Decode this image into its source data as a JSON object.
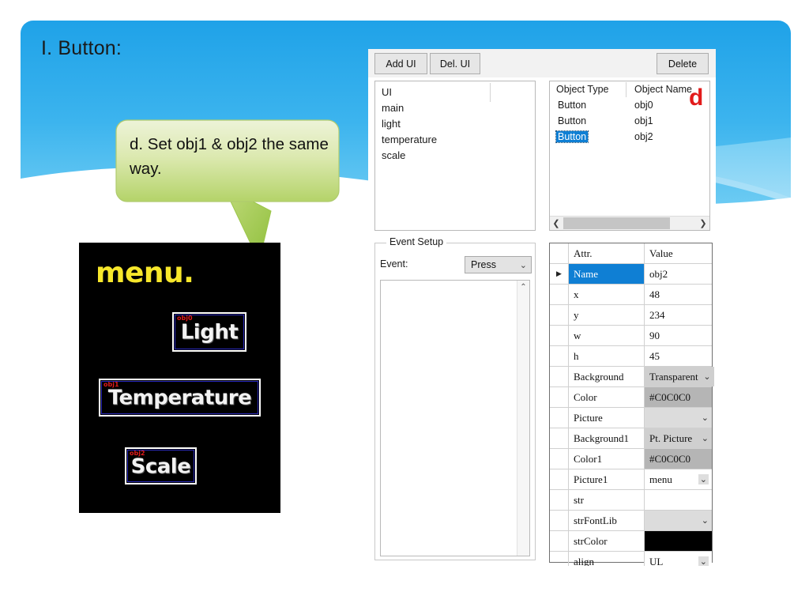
{
  "slide": {
    "title": "I. Button:",
    "callout_text": "d. Set obj1 & obj2 the same way.",
    "accent_blue": "#2BA8E8",
    "callout_green": "#C6DC8A"
  },
  "preview": {
    "title": "menu.",
    "buttons": [
      {
        "label": "Light",
        "tag": "obj0"
      },
      {
        "label": "Temperature",
        "tag": "obj1"
      },
      {
        "label": "Scale",
        "tag": "obj2"
      }
    ]
  },
  "editor": {
    "toolbar": {
      "add_ui": "Add UI",
      "del_ui": "Del. UI",
      "delete": "Delete"
    },
    "ui_list": {
      "header": "UI",
      "items": [
        "main",
        "light",
        "temperature",
        "scale"
      ]
    },
    "object_list": {
      "headers": [
        "Object Type",
        "Object Name"
      ],
      "rows": [
        {
          "type": "Button",
          "name": "obj0",
          "selected": false
        },
        {
          "type": "Button",
          "name": "obj1",
          "selected": false
        },
        {
          "type": "Button",
          "name": "obj2",
          "selected": true
        }
      ],
      "annotation": "d",
      "annotation_color": "#E21B1B",
      "scroll_left_icon": "chevron-left",
      "scroll_right_icon": "chevron-right"
    },
    "event_setup": {
      "legend": "Event Setup",
      "event_label": "Event:",
      "event_value": "Press",
      "code_value": ""
    },
    "property_grid": {
      "headers": [
        "",
        "Attr.",
        "Value"
      ],
      "rows": [
        {
          "marker": "▶",
          "attr": "Name",
          "value": "obj2",
          "selected": true,
          "style": "white"
        },
        {
          "marker": "",
          "attr": "x",
          "value": "48",
          "selected": false,
          "style": "white"
        },
        {
          "marker": "",
          "attr": "y",
          "value": "234",
          "selected": false,
          "style": "white"
        },
        {
          "marker": "",
          "attr": "w",
          "value": "90",
          "selected": false,
          "style": "white"
        },
        {
          "marker": "",
          "attr": "h",
          "value": "45",
          "selected": false,
          "style": "white"
        },
        {
          "marker": "",
          "attr": "Background",
          "value": "Transparent",
          "selected": false,
          "style": "combo"
        },
        {
          "marker": "",
          "attr": "Color",
          "value": "#C0C0C0",
          "selected": false,
          "style": "gray"
        },
        {
          "marker": "",
          "attr": "Picture",
          "value": "",
          "selected": false,
          "style": "combo"
        },
        {
          "marker": "",
          "attr": "Background1",
          "value": "Pt. Picture",
          "selected": false,
          "style": "combo"
        },
        {
          "marker": "",
          "attr": "Color1",
          "value": "#C0C0C0",
          "selected": false,
          "style": "gray"
        },
        {
          "marker": "",
          "attr": "Picture1",
          "value": "menu",
          "selected": false,
          "style": "combo-white"
        },
        {
          "marker": "",
          "attr": "str",
          "value": "",
          "selected": false,
          "style": "white"
        },
        {
          "marker": "",
          "attr": "strFontLib",
          "value": "",
          "selected": false,
          "style": "combo"
        },
        {
          "marker": "",
          "attr": "strColor",
          "value": "",
          "selected": false,
          "style": "black"
        },
        {
          "marker": "",
          "attr": "align",
          "value": "UL",
          "selected": false,
          "style": "combo-white"
        }
      ]
    }
  }
}
